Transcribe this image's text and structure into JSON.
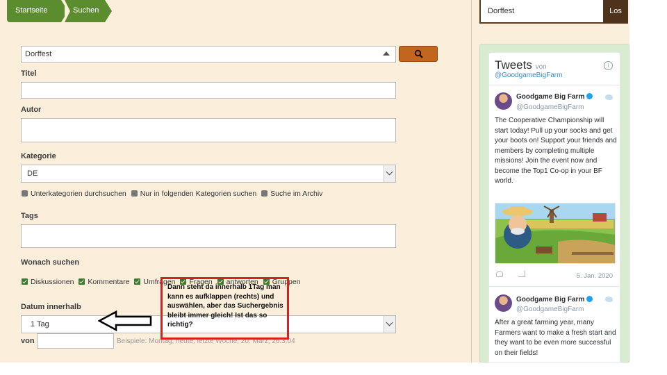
{
  "breadcrumb": [
    "Startseite",
    "Suchen"
  ],
  "search": {
    "value": "Dorffest"
  },
  "form": {
    "titel_label": "Titel",
    "autor_label": "Autor",
    "kategorie_label": "Kategorie",
    "kategorie_value": "DE",
    "kategorie_options": [
      "Unterkategorien durchsuchen",
      "Nur in folgenden Kategorien suchen",
      "Suche im Archiv"
    ],
    "tags_label": "Tags",
    "wonach_label": "Wonach suchen",
    "wonach_options": [
      "Diskussionen",
      "Kommentare",
      "Umfragen",
      "Fragen",
      "antworten",
      "Gruppen"
    ],
    "datum_label": "Datum innerhalb",
    "datum_value": "1 Tag",
    "von_label": "von",
    "hint": "Beispiele: Montag, heute, letzte Woche, 20. März, 26.3.04"
  },
  "sidebar": {
    "search_value": "Dorffest",
    "search_button": "Los",
    "tweets_title": "Tweets",
    "tweets_by": "von",
    "tweets_user": "@GoodgameBigFarm",
    "tweets": [
      {
        "name": "Goodgame Big Farm",
        "handle": "@GoodgameBigFarm",
        "text": "The Cooperative Championship will start today! Pull up your socks and get your boots on! Support your friends and members by completing multiple missions! Join the event now and become the Top1 Co-op in your BF world.",
        "date": "5. Jan. 2020"
      },
      {
        "name": "Goodgame Big Farm",
        "handle": "@GoodgameBigFarm",
        "text": "After a great farming year, many Farmers want to make a fresh start and they want to be even more successful on their fields!"
      }
    ]
  },
  "annotation": {
    "text": "Dann steht da innerhalb 1Tag man kann es aufklappen (rechts) und auswählen, aber das Suchergebnis bleibt immer gleich! Ist das so richtig?"
  },
  "colors": {
    "green": "#5b8d2f",
    "orange": "#c3641f",
    "brown": "#4e321b",
    "red": "#d72020"
  }
}
